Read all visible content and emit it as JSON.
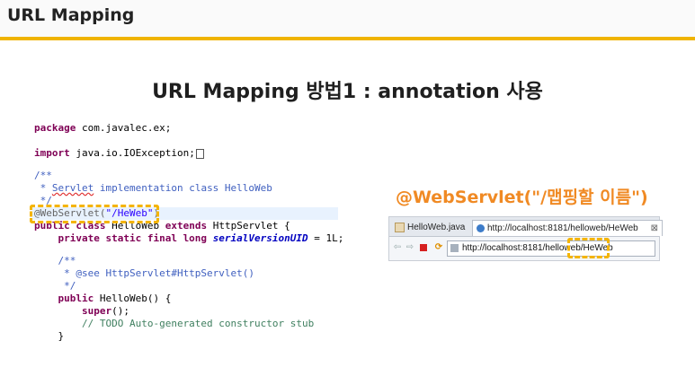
{
  "header": {
    "title": "URL Mapping"
  },
  "slide": {
    "title": "URL Mapping 방법1 : annotation 사용",
    "callout": "@WebServlet(\"/맵핑할 이름\")"
  },
  "code": {
    "pkg_kw": "package",
    "pkg_name": " com.javalec.ex;",
    "import_kw": "import",
    "import_name": " java.io.IOException;",
    "c1": "/**",
    "c2_pre": " * ",
    "c2_servlet": "Servlet",
    "c2_rest": " implementation class HelloWeb",
    "c3": " */",
    "ann": "@WebServlet(",
    "ann_str": "\"/HeWeb\"",
    "ann_end": ")",
    "class_kw": "public class",
    "class_name": " HelloWeb ",
    "extends_kw": "extends",
    "class_rest": " HttpServlet {",
    "field_kw": "    private static final long",
    "field_name": "serialVersionUID",
    "field_rest": " = 1L;",
    "d1": "    /**",
    "d2": "     * @see HttpServlet#HttpServlet()",
    "d3": "     */",
    "ctor_kw": "    public",
    "ctor_rest": " HelloWeb() {",
    "super_kw": "        super",
    "super_rest": "();",
    "todo": "        // TODO Auto-generated constructor stub",
    "close": "    }"
  },
  "browser": {
    "tab1": "HelloWeb.java",
    "tab2": "http://localhost:8181/helloweb/HeWeb",
    "tab2_close": "⊠",
    "url": "http://localhost:8181/helloweb/HeWeb"
  }
}
